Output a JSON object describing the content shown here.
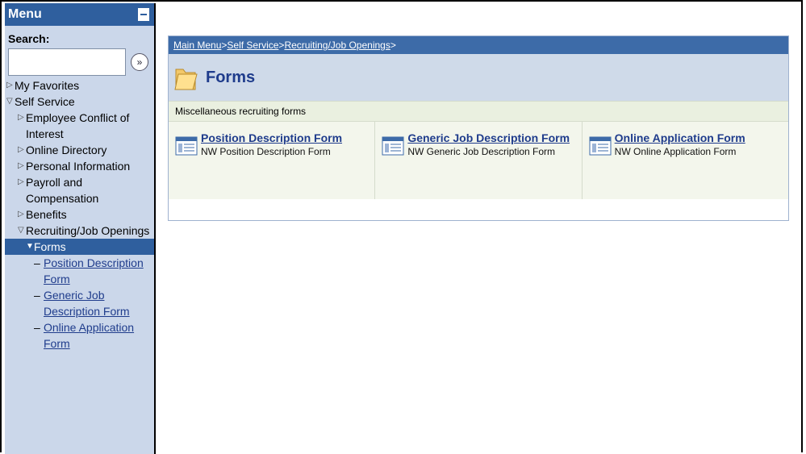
{
  "menu": {
    "title": "Menu",
    "search_label": "Search:",
    "search_value": "",
    "go_glyph": "»",
    "items": [
      {
        "label": "My Favorites",
        "level": 0
      },
      {
        "label": "Self Service",
        "level": 0
      },
      {
        "label": "Employee Conflict of",
        "label2": "Interest",
        "level": 1
      },
      {
        "label": "Online Directory",
        "level": 1
      },
      {
        "label": "Personal Information",
        "level": 1
      },
      {
        "label": "Payroll and Compensation",
        "level": 1
      },
      {
        "label": "Benefits",
        "level": 1
      },
      {
        "label": "Recruiting/Job Openings",
        "level": 1
      },
      {
        "label": "Forms",
        "level": 2
      },
      {
        "label": "Position Description",
        "label2": "Form",
        "level": 3
      },
      {
        "label": "Generic Job",
        "label2": "Description Form",
        "level": 3
      },
      {
        "label": "Online Application",
        "label2": "Form",
        "level": 3
      }
    ]
  },
  "breadcrumb": {
    "items": [
      "Main Menu",
      "Self Service",
      "Recruiting/Job Openings"
    ],
    "separator": " > ",
    "trailing": " >"
  },
  "page": {
    "title": "Forms",
    "description": "Miscellaneous recruiting forms",
    "folder_icon": "folder-icon"
  },
  "cards": [
    {
      "title": "Position Description Form",
      "subtitle": "NW Position Description Form",
      "icon": "form-icon"
    },
    {
      "title": "Generic Job Description Form",
      "subtitle": "NW Generic Job Description Form",
      "icon": "form-icon"
    },
    {
      "title": "Online Application Form",
      "subtitle": "NW Online Application Form",
      "icon": "form-icon"
    }
  ],
  "colors": {
    "menu_header": "#2f5f9e",
    "sidebar_bg": "#cbd7ea",
    "breadcrumb_bar": "#3d6ba8",
    "title_bg": "#cfdae9",
    "link": "#1f3c8c"
  }
}
